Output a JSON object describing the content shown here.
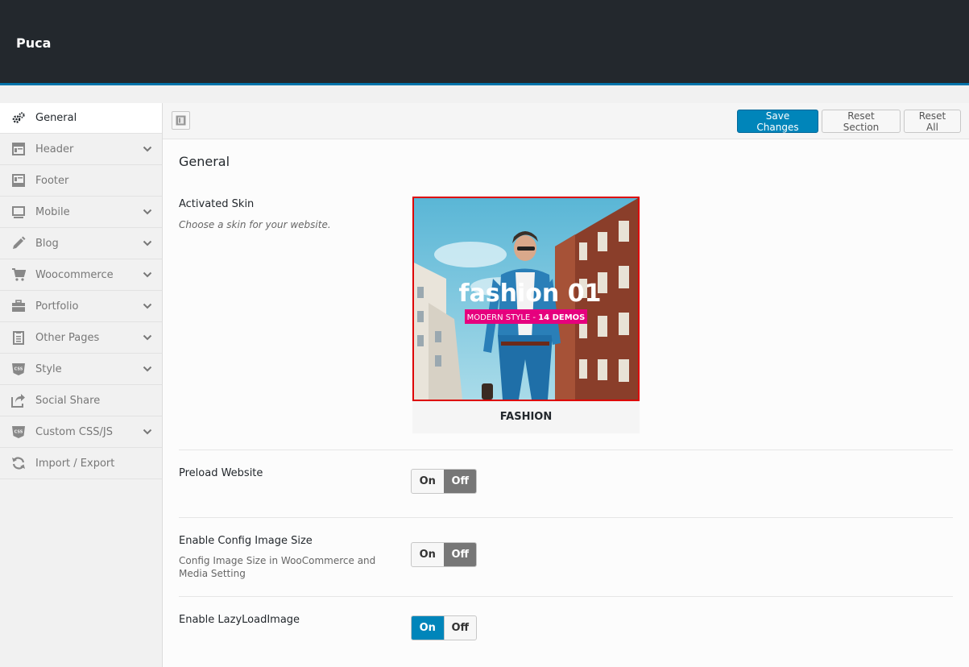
{
  "app": {
    "brand": "Puca"
  },
  "sidebar": {
    "items": [
      {
        "label": "General",
        "icon": "gears-icon",
        "active": true,
        "expandable": false
      },
      {
        "label": "Header",
        "icon": "layout-header-icon",
        "expandable": true
      },
      {
        "label": "Footer",
        "icon": "layout-footer-icon",
        "expandable": false
      },
      {
        "label": "Mobile",
        "icon": "monitor-icon",
        "expandable": true
      },
      {
        "label": "Blog",
        "icon": "pencil-icon",
        "expandable": true
      },
      {
        "label": "Woocommerce",
        "icon": "cart-icon",
        "expandable": true
      },
      {
        "label": "Portfolio",
        "icon": "briefcase-icon",
        "expandable": true
      },
      {
        "label": "Other Pages",
        "icon": "clipboard-icon",
        "expandable": true
      },
      {
        "label": "Style",
        "icon": "css-icon",
        "expandable": true
      },
      {
        "label": "Social Share",
        "icon": "share-icon",
        "expandable": false
      },
      {
        "label": "Custom CSS/JS",
        "icon": "css-icon",
        "expandable": true
      },
      {
        "label": "Import / Export",
        "icon": "refresh-icon",
        "expandable": false
      }
    ]
  },
  "toolbar": {
    "save_label": "Save Changes",
    "reset_section_label": "Reset Section",
    "reset_all_label": "Reset All"
  },
  "main": {
    "section_title": "General",
    "activated_skin": {
      "title": "Activated Skin",
      "description": "Choose a skin for your website.",
      "skin_headline": "fashion 01",
      "skin_tag_prefix": "MODERN STYLE - ",
      "skin_tag_bold": "14 DEMOS",
      "skin_name": "FASHION"
    },
    "preload": {
      "title": "Preload Website",
      "on": "On",
      "off": "Off",
      "value": "off"
    },
    "config_image": {
      "title": "Enable Config Image Size",
      "description": "Config Image Size in WooCommerce and Media Setting",
      "on": "On",
      "off": "Off",
      "value": "off"
    },
    "lazyload": {
      "title": "Enable LazyLoadImage",
      "on": "On",
      "off": "Off",
      "value": "on"
    }
  },
  "colors": {
    "topbar": "#23282d",
    "accent": "#0085ba",
    "skin_border": "#dd0000",
    "tag_pink": "#e6007e"
  }
}
